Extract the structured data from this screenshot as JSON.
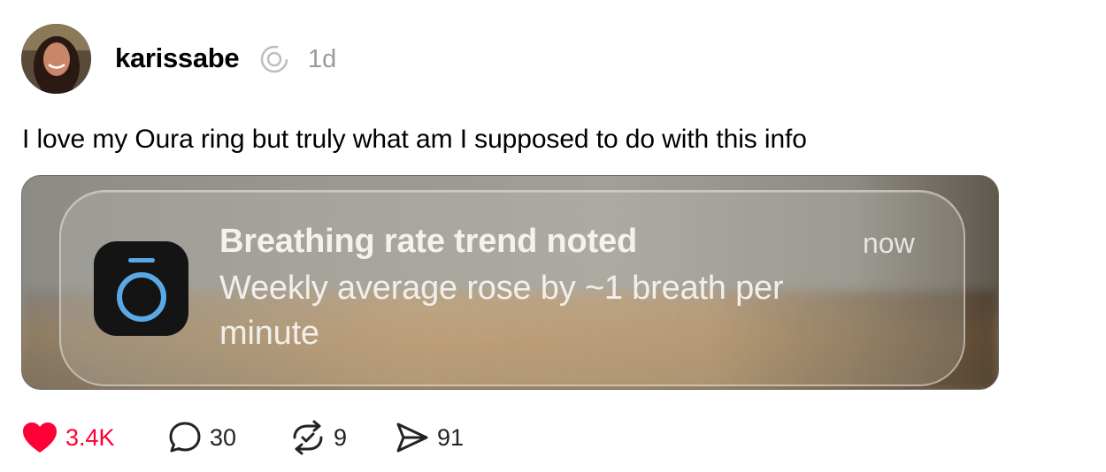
{
  "post": {
    "username": "karissabe",
    "time": "1d",
    "text": "I love my Oura ring but truly what am I supposed to do with this info"
  },
  "notification": {
    "title": "Breathing rate trend noted",
    "body": "Weekly average rose by ~1 breath per minute",
    "time": "now",
    "app_icon": "oura-ring-icon"
  },
  "actions": {
    "likes": "3.4K",
    "comments": "30",
    "reposts": "9",
    "shares": "91",
    "liked": true,
    "like_color": "#ff0036"
  }
}
